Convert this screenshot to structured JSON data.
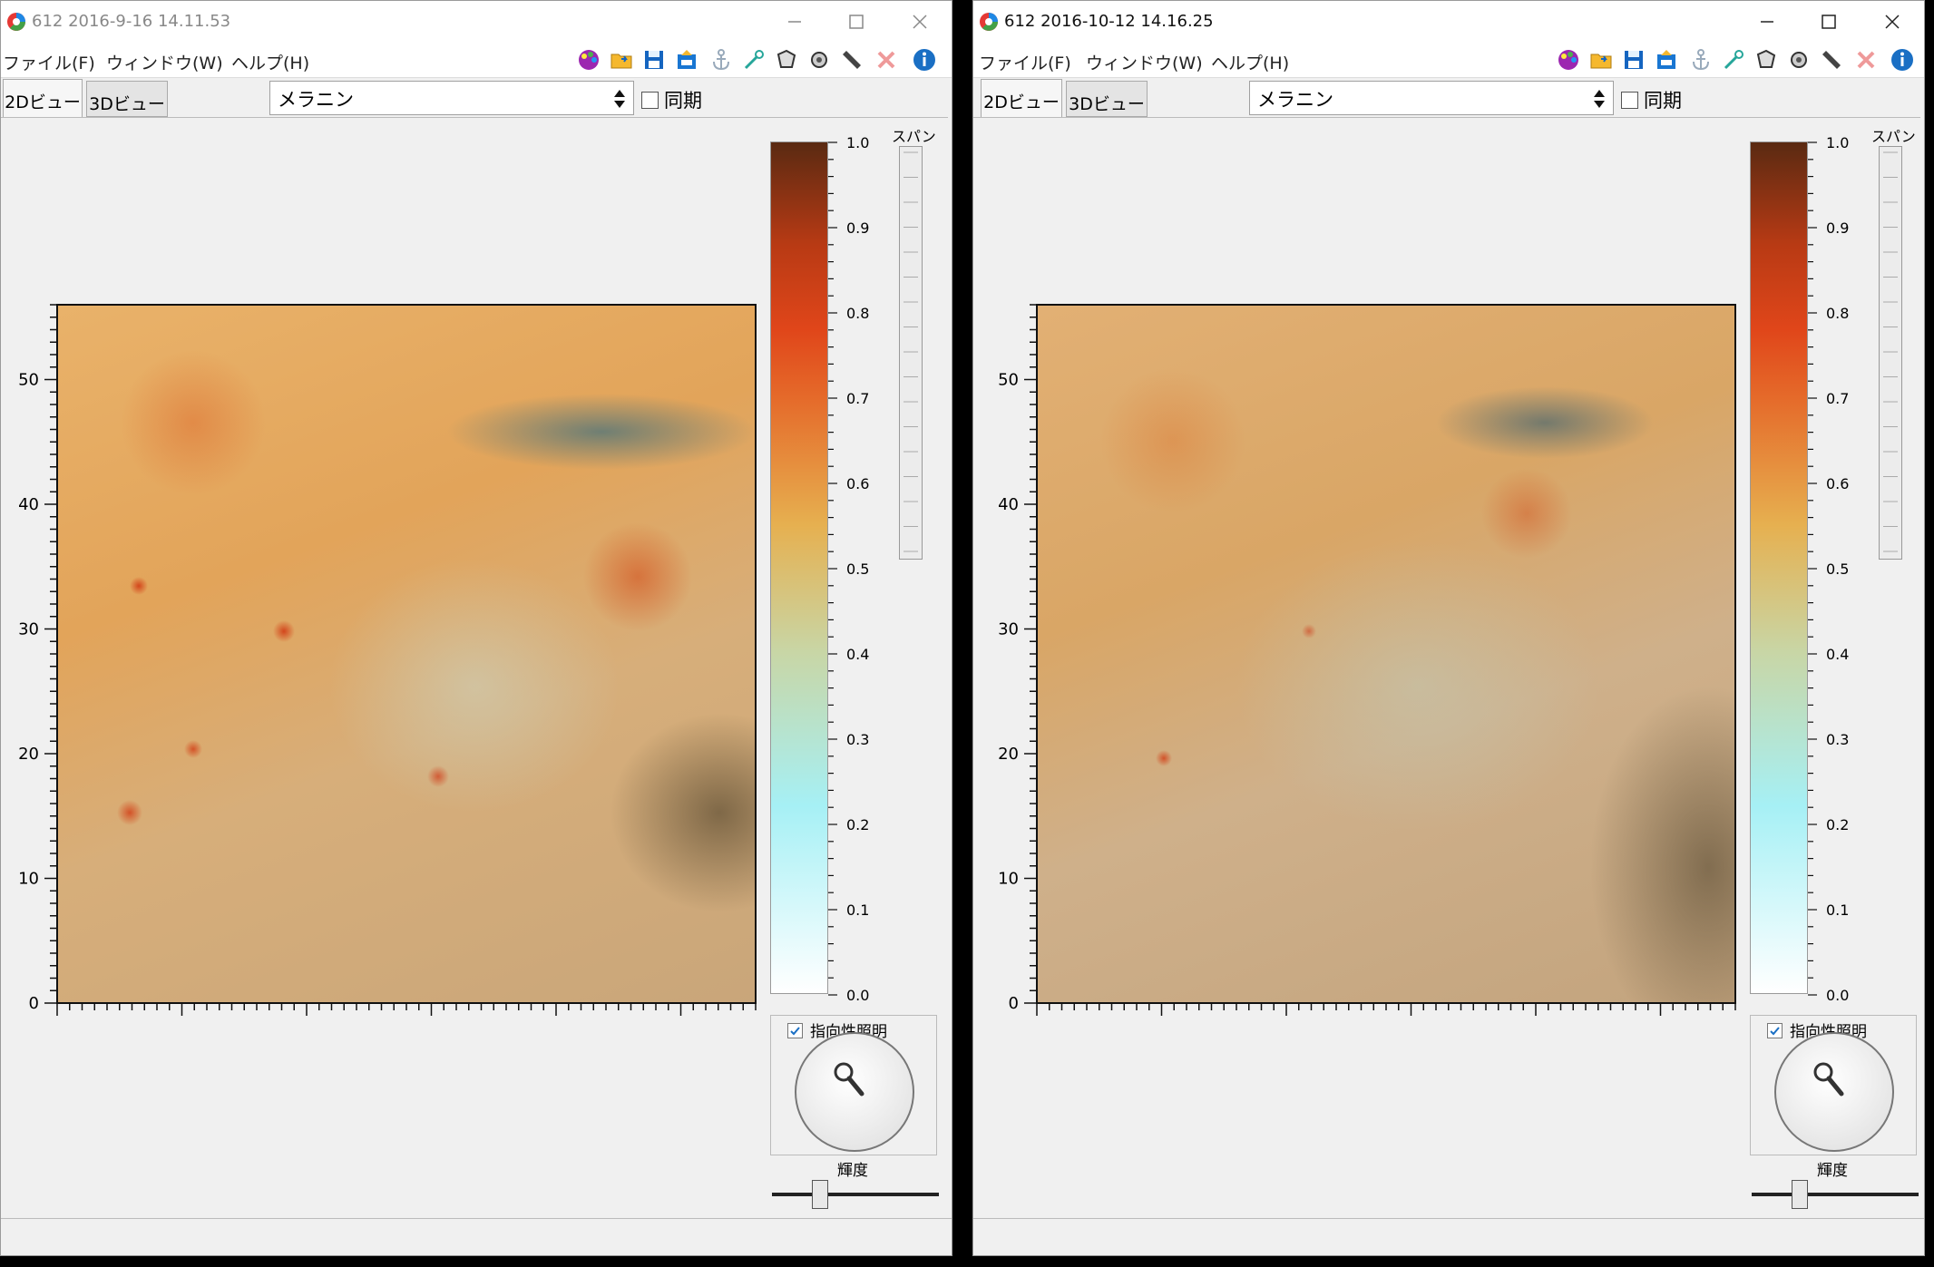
{
  "windows": [
    {
      "title": "612 2016-9-16 14.11.53",
      "menu": [
        "ファイル(F)",
        "ウィンドウ(W)",
        "ヘルプ(H)"
      ],
      "tabs": [
        "2Dビュー",
        "3Dビュー"
      ],
      "select_value": "メラニン",
      "sync_label": "同期",
      "span_label": "スパン",
      "directional_label": "指向性照明",
      "brightness_label": "輝度",
      "axis_x_ticks": [
        "0",
        "10",
        "20",
        "30",
        "40",
        "50"
      ],
      "axis_y_ticks": [
        "0",
        "10",
        "20",
        "30",
        "40",
        "50"
      ],
      "colorbar_ticks": [
        "0.0",
        "0.1",
        "0.2",
        "0.3",
        "0.4",
        "0.5",
        "0.6",
        "0.7",
        "0.8",
        "0.9",
        "1.0"
      ]
    },
    {
      "title": "612 2016-10-12 14.16.25",
      "menu": [
        "ファイル(F)",
        "ウィンドウ(W)",
        "ヘルプ(H)"
      ],
      "tabs": [
        "2Dビュー",
        "3Dビュー"
      ],
      "select_value": "メラニン",
      "sync_label": "同期",
      "span_label": "スパン",
      "directional_label": "指向性照明",
      "brightness_label": "輝度",
      "axis_x_ticks": [
        "0",
        "10",
        "20",
        "30",
        "40",
        "50"
      ],
      "axis_y_ticks": [
        "0",
        "10",
        "20",
        "30",
        "40",
        "50"
      ],
      "colorbar_ticks": [
        "0.0",
        "0.1",
        "0.2",
        "0.3",
        "0.4",
        "0.5",
        "0.6",
        "0.7",
        "0.8",
        "0.9",
        "1.0"
      ]
    }
  ],
  "icons": [
    "app-logo-icon",
    "minimize-icon",
    "maximize-icon",
    "close-icon",
    "palette-icon",
    "open-folder-icon",
    "save-icon",
    "export-icon",
    "anchor-icon",
    "needle-icon",
    "polygon-icon",
    "circle-icon",
    "ruler-icon",
    "delete-icon",
    "info-icon"
  ],
  "colors": {
    "accent_blue": "#1a6fc4",
    "delete_red": "#e53935",
    "colormap_top": "#5a2a12",
    "colormap_mid": "#e0461a",
    "colormap_low": "#a6f0f5"
  }
}
